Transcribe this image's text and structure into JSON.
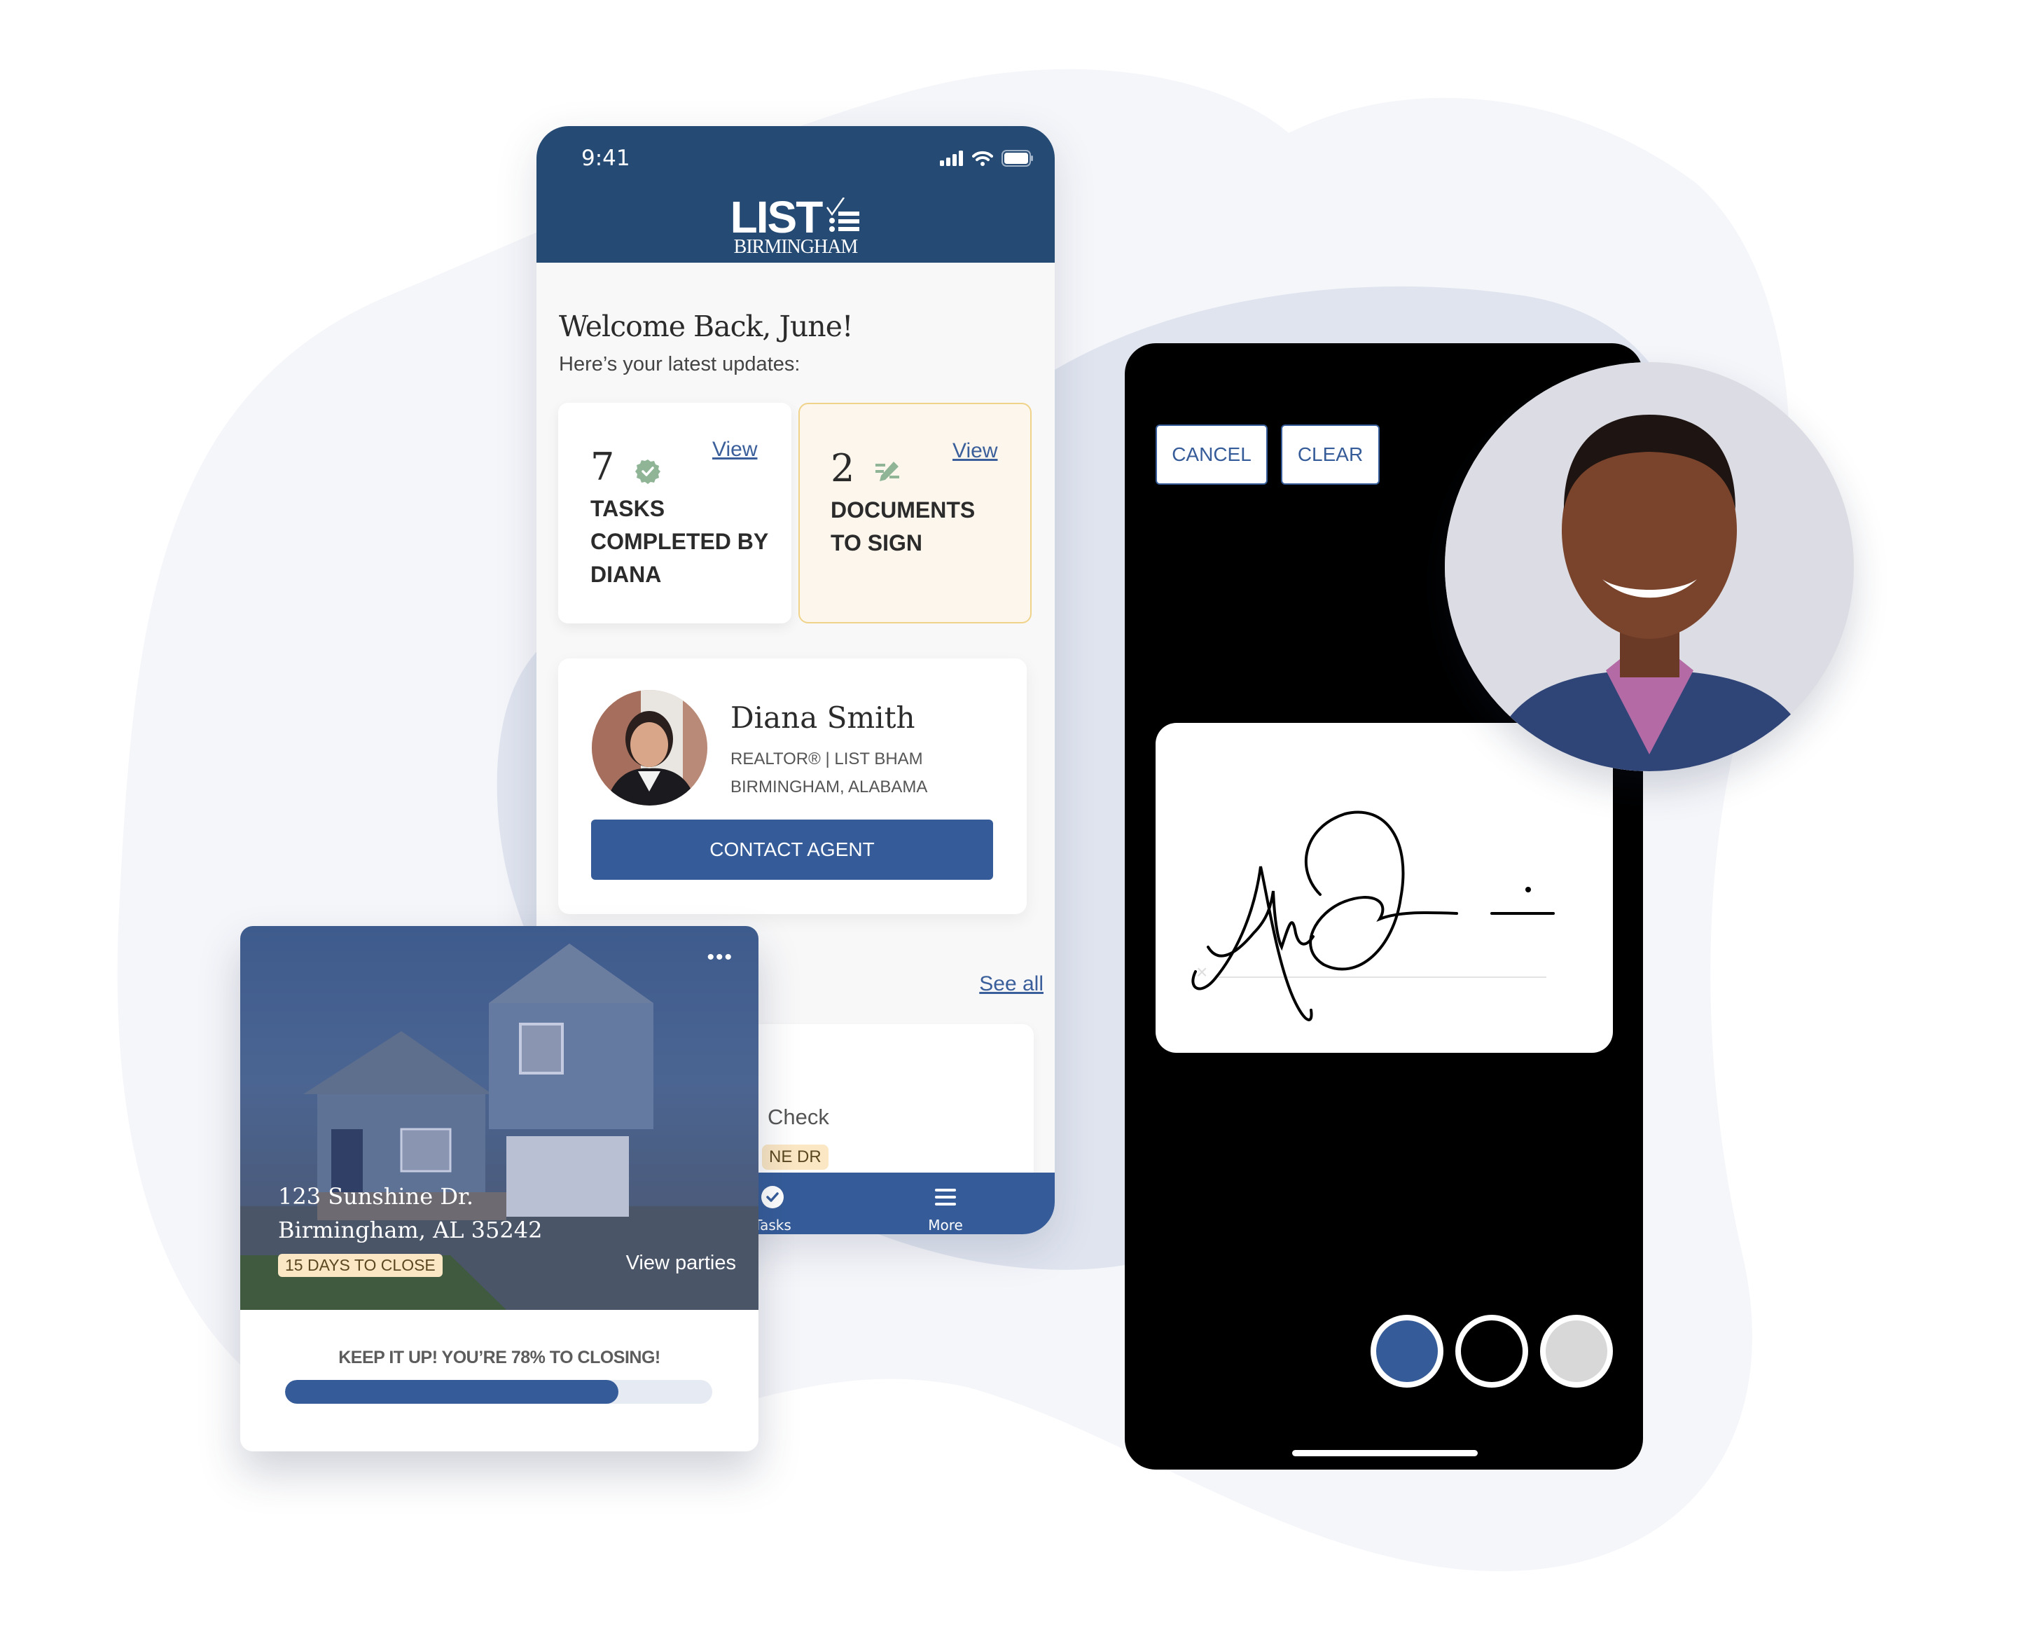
{
  "colors": {
    "brand_navy": "#254a73",
    "brand_blue": "#355c99",
    "accent_gold": "#f0d38b",
    "tag_bg": "#fbe7c4",
    "icon_green": "#8fb596",
    "swatch_blue": "#355c99",
    "swatch_black": "#000000",
    "swatch_gray": "#d8d8d8"
  },
  "phone_home": {
    "status_bar": {
      "time": "9:41",
      "icons": [
        "signal-icon",
        "wifi-icon",
        "battery-icon"
      ]
    },
    "logo": {
      "main": "LIST",
      "sub": "BIRMINGHAM"
    },
    "welcome": "Welcome Back, June!",
    "subtitle": "Here’s your latest updates:",
    "stats": [
      {
        "count": "7",
        "icon": "verified-check-icon",
        "label_lines": [
          "TASKS",
          "COMPLETED BY",
          "DIANA"
        ],
        "link": "View"
      },
      {
        "count": "2",
        "icon": "sign-pen-icon",
        "label_lines": [
          "DOCUMENTS",
          "TO SIGN"
        ],
        "link": "View"
      }
    ],
    "agent": {
      "name": "Diana Smith",
      "title": "REALTOR® | LIST BHAM",
      "location": "BIRMINGHAM, ALABAMA",
      "contact_button": "CONTACT AGENT"
    },
    "see_all": "See all",
    "task_card": {
      "title_fragment": "Check",
      "tag_fragment": "NE DR"
    },
    "bottom_nav": [
      {
        "label": "Tasks",
        "icon": "check-circle-icon"
      },
      {
        "label": "More",
        "icon": "hamburger-menu-icon"
      }
    ]
  },
  "house_card": {
    "address_line1": "123 Sunshine Dr.",
    "address_line2": "Birmingham, AL 35242",
    "days_tag": "15 DAYS TO CLOSE",
    "view_parties": "View parties",
    "more_icon": "•••",
    "progress_label": "KEEP IT UP! YOU’RE 78% TO CLOSING!",
    "progress_percent": 78
  },
  "signature_phone": {
    "cancel_button": "CANCEL",
    "clear_button": "CLEAR",
    "clear_mark": "×",
    "pen_colors": [
      "blue",
      "black",
      "gray"
    ],
    "selected_color": "blue"
  }
}
